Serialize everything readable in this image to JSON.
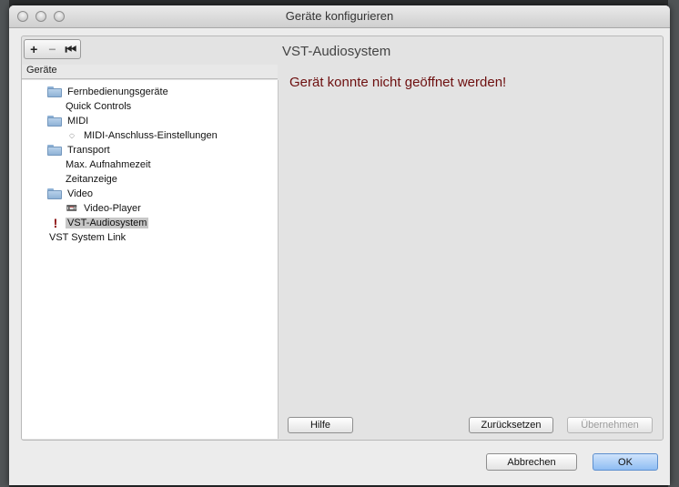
{
  "window": {
    "title": "Geräte konfigurieren"
  },
  "toolbar": {
    "add_label": "+",
    "remove_label": "−",
    "reset_label": "⏮"
  },
  "tree": {
    "header": "Geräte",
    "items": [
      {
        "label": "Fernbedienungsgeräte",
        "icon": "folder-icon"
      },
      {
        "label": "Quick Controls",
        "icon": ""
      },
      {
        "label": "MIDI",
        "icon": "folder-icon"
      },
      {
        "label": "MIDI-Anschluss-Einstellungen",
        "icon": "midi-port-icon",
        "glyph": "◌"
      },
      {
        "label": "Transport",
        "icon": "folder-icon"
      },
      {
        "label": "Max. Aufnahmezeit",
        "icon": ""
      },
      {
        "label": "Zeitanzeige",
        "icon": ""
      },
      {
        "label": "Video",
        "icon": "folder-icon"
      },
      {
        "label": "Video-Player",
        "icon": "video-player-icon",
        "glyph": "📼"
      },
      {
        "label": "VST-Audiosystem",
        "icon": "warning-icon",
        "glyph": "!"
      },
      {
        "label": "VST System Link",
        "icon": ""
      }
    ]
  },
  "panel": {
    "title": "VST-Audiosystem",
    "error": "Gerät konnte nicht geöffnet werden!"
  },
  "buttons": {
    "help": "Hilfe",
    "reset": "Zurücksetzen",
    "apply": "Übernehmen",
    "cancel": "Abbrechen",
    "ok": "OK"
  },
  "colors": {
    "error": "#6d0f0f",
    "default_button": "#8fbdf3",
    "selection": "#c7c7c7"
  }
}
